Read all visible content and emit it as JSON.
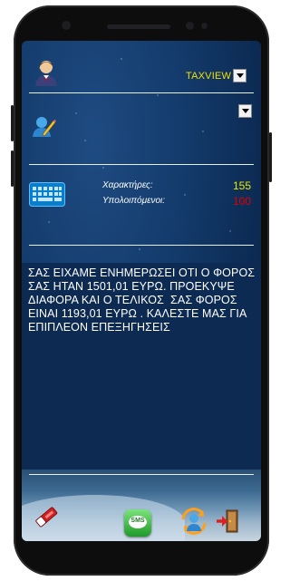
{
  "header": {
    "combo_value": "TAXVIEW"
  },
  "counters": {
    "chars_label": "Χαρακτήρες:",
    "chars_value": "155",
    "remaining_label": "Υπολοιπόμενοι:",
    "remaining_value": "100"
  },
  "message": {
    "text": "ΣΑΣ ΕΙΧΑΜΕ ΕΝΗΜΕΡΩΣΕΙ ΟΤΙ Ο ΦΟΡΟΣ ΣΑΣ ΗΤΑΝ 1501,01 ΕΥΡΩ. ΠΡΟΕΚΥΨΕ ΔΙΑΦΟΡΑ ΚΑΙ Ο ΤΕΛΙΚΟΣ  ΣΑΣ ΦΟΡΟΣ ΕΙΝΑΙ 1193,01 ΕΥΡΩ . ΚΑΛΕΣΤΕ ΜΑΣ ΓΙΑ ΕΠΙΠΛΕΟΝ ΕΠΕΞΗΓΗΣΕΙΣ"
  },
  "toolbar": {
    "sms_label": "SMS"
  },
  "colors": {
    "chars_value": "#e8e800",
    "remaining_value": "#e00000",
    "combo_text": "#f0e000",
    "message_bg": "#0c2a52"
  },
  "icons": {
    "user": "user-avatar-icon",
    "edit": "edit-user-icon",
    "keyboard": "keyboard-icon",
    "eraser": "eraser-icon",
    "sms": "sms-icon",
    "contacts_sync": "contacts-sync-icon",
    "exit": "exit-door-icon"
  }
}
